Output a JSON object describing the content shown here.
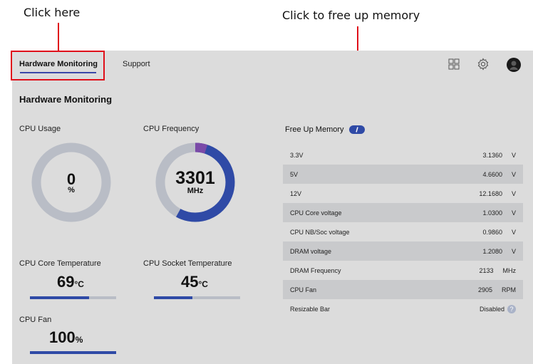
{
  "annotations": {
    "click_here": "Click here",
    "free_up_memory_hint": "Click to free up memory"
  },
  "tabs": [
    {
      "label": "Hardware Monitoring",
      "active": true
    },
    {
      "label": "Support",
      "active": false
    }
  ],
  "header_icons": [
    "grid-icon",
    "gear-icon",
    "avatar-icon"
  ],
  "section_title": "Hardware Monitoring",
  "cpu_usage": {
    "label": "CPU Usage",
    "value": "0",
    "unit": "%",
    "fraction": 0
  },
  "cpu_frequency": {
    "label": "CPU Frequency",
    "value": "3301",
    "unit": "MHz",
    "fraction": 0.58
  },
  "cpu_core_temp": {
    "label": "CPU Core Temperature",
    "value": "69",
    "unit": "°C",
    "fraction": 0.69
  },
  "cpu_socket_temp": {
    "label": "CPU Socket Temperature",
    "value": "45",
    "unit": "°C",
    "fraction": 0.45
  },
  "cpu_fan": {
    "label": "CPU Fan",
    "value": "100",
    "unit": "%",
    "fraction": 1.0
  },
  "free_up_memory": {
    "label": "Free Up Memory"
  },
  "readings": [
    {
      "name": "3.3V",
      "value": "3.1360",
      "unit": "V"
    },
    {
      "name": "5V",
      "value": "4.6600",
      "unit": "V"
    },
    {
      "name": "12V",
      "value": "12.1680",
      "unit": "V"
    },
    {
      "name": "CPU Core voltage",
      "value": "1.0300",
      "unit": "V"
    },
    {
      "name": "CPU NB/Soc voltage",
      "value": "0.9860",
      "unit": "V"
    },
    {
      "name": "DRAM voltage",
      "value": "1.2080",
      "unit": "V"
    },
    {
      "name": "DRAM Frequency",
      "value": "2133",
      "unit": "MHz"
    },
    {
      "name": "CPU Fan",
      "value": "2905",
      "unit": "RPM"
    },
    {
      "name": "Resizable Bar",
      "value": "Disabled",
      "unit": ""
    }
  ],
  "colors": {
    "accent": "#2f4aa6",
    "ring_track": "#b9bdc6",
    "ring_top": "#7a4aa8",
    "callout": "#e0101a"
  }
}
